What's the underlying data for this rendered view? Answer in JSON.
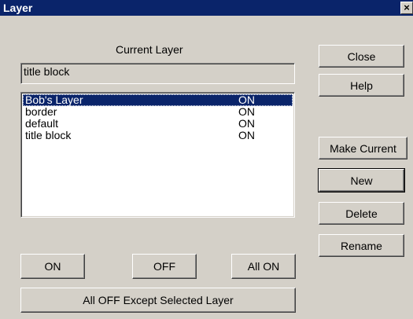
{
  "window": {
    "title": "Layer",
    "close_glyph": "×"
  },
  "current_layer": {
    "label": "Current Layer",
    "value": "title block"
  },
  "layers": [
    {
      "name": "Bob's Layer",
      "state": "ON",
      "selected": true
    },
    {
      "name": "border",
      "state": "ON",
      "selected": false
    },
    {
      "name": "default",
      "state": "ON",
      "selected": false
    },
    {
      "name": "title block",
      "state": "ON",
      "selected": false
    }
  ],
  "buttons": {
    "close": "Close",
    "help": "Help",
    "make_current": "Make Current",
    "new": "New",
    "delete": "Delete",
    "rename": "Rename",
    "on": "ON",
    "off": "OFF",
    "all_on": "All ON",
    "all_off_except": "All OFF Except Selected Layer"
  },
  "colors": {
    "titlebar": "#0a246a",
    "face": "#d4d0c8",
    "selection": "#0a246a"
  }
}
